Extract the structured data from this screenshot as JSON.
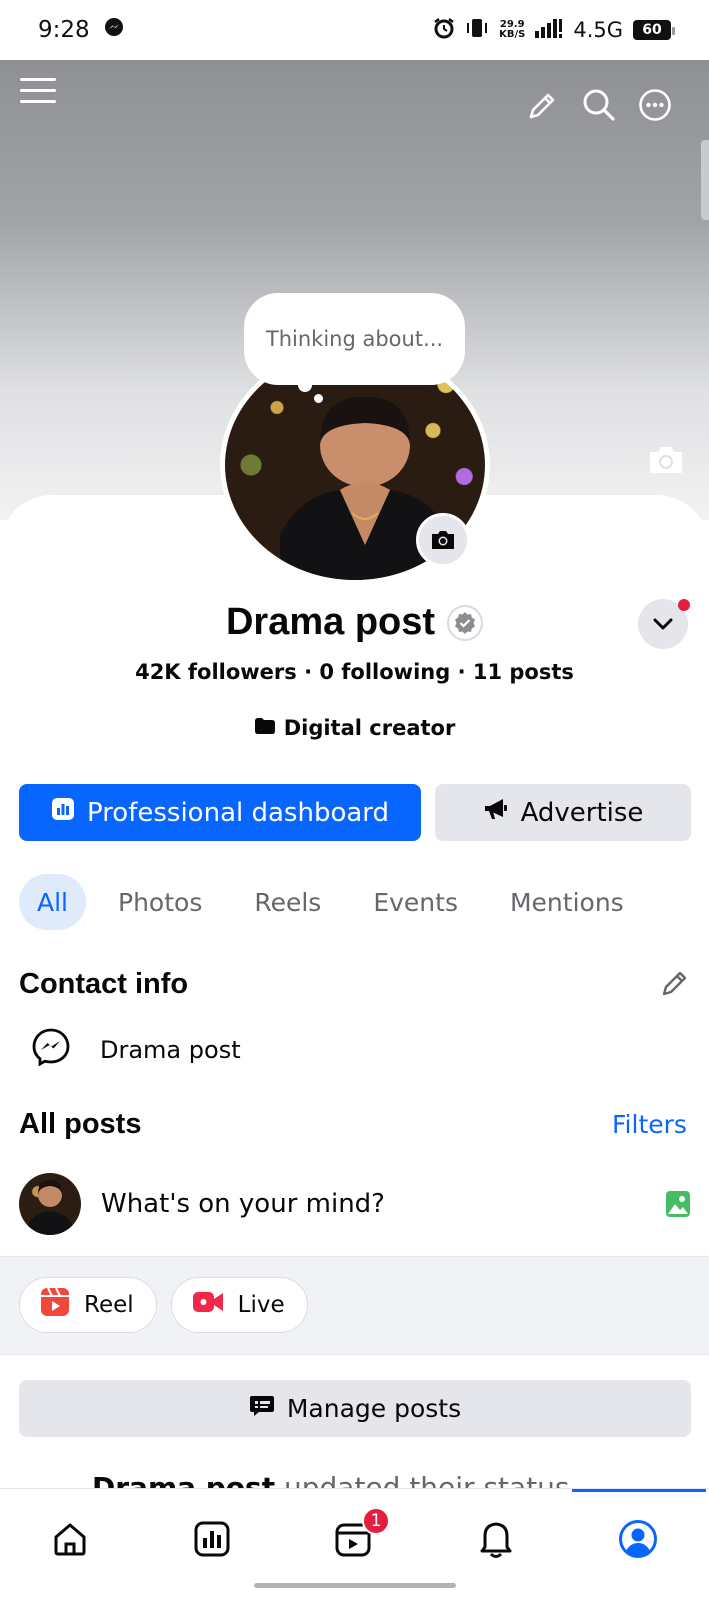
{
  "status_bar": {
    "time": "9:28",
    "net_speed_value": "29.9",
    "net_speed_unit": "KB/S",
    "network": "4.5G",
    "battery": "60"
  },
  "profile": {
    "thought_bubble": "Thinking about...",
    "name": "Drama post",
    "stats": "42K followers · 0 following · 11 posts",
    "category": "Digital creator"
  },
  "actions": {
    "primary_label": "Professional dashboard",
    "secondary_label": "Advertise"
  },
  "tabs": [
    {
      "label": "All",
      "active": true
    },
    {
      "label": "Photos",
      "active": false
    },
    {
      "label": "Reels",
      "active": false
    },
    {
      "label": "Events",
      "active": false
    },
    {
      "label": "Mentions",
      "active": false
    }
  ],
  "contact": {
    "title": "Contact info",
    "messenger": "Drama post"
  },
  "posts": {
    "title": "All posts",
    "filters": "Filters",
    "composer_placeholder": "What's on your mind?",
    "reel_label": "Reel",
    "live_label": "Live",
    "manage_label": "Manage posts",
    "peek_author": "Drama post",
    "peek_text": " updated their status"
  },
  "nav": {
    "video_badge": "1"
  },
  "colors": {
    "accent": "#0866ff",
    "badge": "#e41e3f",
    "reel": "#f0493c",
    "live": "#f0284a",
    "photo": "#45bd62"
  }
}
